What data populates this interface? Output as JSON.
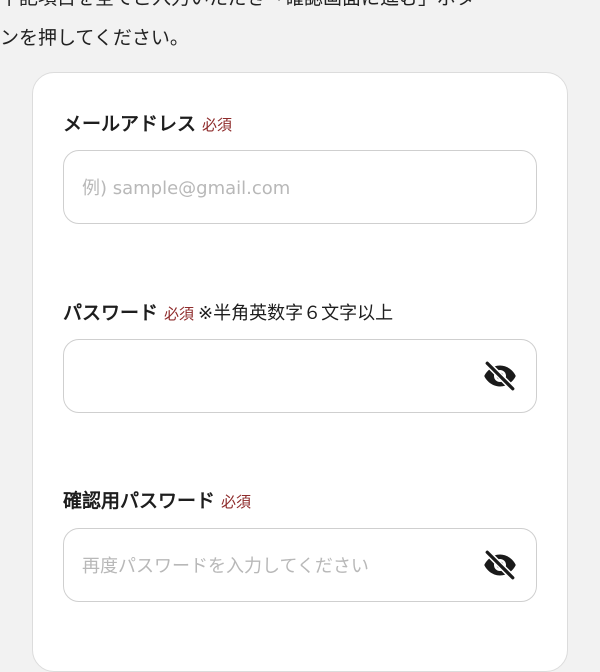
{
  "intro": {
    "line1": "下記項目を全てご入力いただき「確認画面に進む」ボタ",
    "line2": "ンを押してください。"
  },
  "form": {
    "email": {
      "label": "メールアドレス",
      "required": "必須",
      "placeholder": "例) sample@gmail.com"
    },
    "password": {
      "label": "パスワード",
      "required": "必須",
      "note": "※半角英数字６文字以上",
      "placeholder": "",
      "toggle_icon": "eye-slash-icon"
    },
    "confirm_password": {
      "label": "確認用パスワード",
      "required": "必須",
      "placeholder": "再度パスワードを入力してください",
      "toggle_icon": "eye-slash-icon"
    }
  },
  "colors": {
    "background": "#f2f2f2",
    "required": "#8e2b2b",
    "placeholder": "#b8b8b8"
  }
}
